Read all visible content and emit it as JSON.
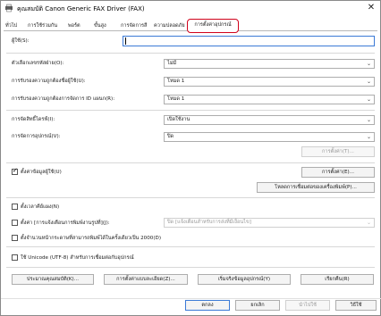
{
  "window": {
    "title": "คุณสมบัติ Canon Generic FAX Driver (FAX)"
  },
  "tabs": [
    {
      "label": "ทั่วไป"
    },
    {
      "label": "การใช้ร่วมกัน"
    },
    {
      "label": "พอร์ต"
    },
    {
      "label": "ขั้นสูง"
    },
    {
      "label": "การจัดการสี"
    },
    {
      "label": "ความปลอดภัย"
    },
    {
      "label": "การตั้งค่าอุปกรณ์"
    }
  ],
  "active_tab": "การตั้งค่าอุปกรณ์",
  "fields": {
    "user_label": "ผู้ใช้(S):",
    "user_value": "",
    "select_dept_label": "ตัวเลือกเลขรหัสฝ่าย(O):",
    "select_dept_value": "ไม่มี",
    "user_auth_label": "การรับรองความถูกต้องชื่อผู้ใช้(U):",
    "user_auth_value": "โหมด 1",
    "dept_auth_label": "การรับรองความถูกต้องการจัดการ ID แผนก(R):",
    "dept_auth_value": "โหมด 1",
    "auto_detect_label": "การจัดสิทธิ์ไดรฟ์(I):",
    "auto_detect_value": "เปิดใช้งาน",
    "device_mgmt_label": "การจัดการอุปกรณ์(V):",
    "device_mgmt_value": "ปิด",
    "settings_btn_1": "การตั้งค่า(T)...",
    "edit_print_info_label": "ตั้งค่าข้อมูลผู้ใช้(U)",
    "settings_btn_2": "การตั้งค่า(E)...",
    "get_device_info_btn": "โหลดการเชื่อมต่อของเครื่องพิมพ์(P)...",
    "show_dept_label": "ตั้งเวลาคีย์แผง(N)",
    "set_auth_label": "ตั้งค่า [การแจ้งเตือนการพิมพ์งานรูปที่](J):",
    "set_auth_value": "ปิด [แจ้งเตือนสำหรับการส่งที่มีเงื่อนไข]",
    "japanese_ime_label": "ตั้งจำนวนหน้ากระดาษที่สามารถพิมพ์ได้ในครั้งเดียวเป็น 2000(D)",
    "unicode_label": "ใช้ Unicode (UTF-8) สำหรับการเชื่อมต่อกับอุปกรณ์"
  },
  "bottom_buttons": {
    "about": "ประมาณคุณสมบัติ(K)...",
    "print_settings": "การตั้งค่าแบบละเอียด(Z)...",
    "get_info": "เริ่มจริงข้อมูลอุปกรณ์(Y)",
    "restore": "เรียกคืน(R)"
  },
  "dialog_buttons": {
    "ok": "ตกลง",
    "cancel": "ยกเลิก",
    "apply": "นำไปใช้",
    "help": "วิธีใช้"
  }
}
